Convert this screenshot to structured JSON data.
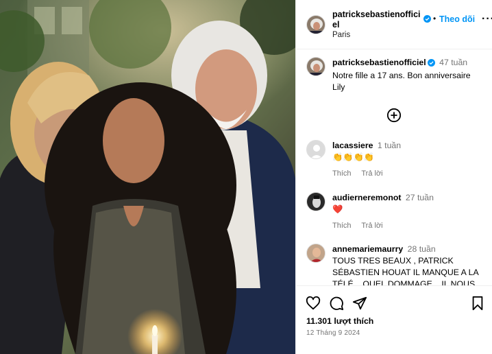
{
  "post_header": {
    "username": "patricksebastienofficiel",
    "follow_label": "Theo dõi",
    "location": "Paris",
    "more_label": "···"
  },
  "caption": {
    "username": "patricksebastienofficiel",
    "time": "47 tuần",
    "text": "Notre fille a 17 ans. Bon anniversaire Lily"
  },
  "load_more_icon": "plus-circle-icon",
  "comments": [
    {
      "username": "lacassiere",
      "time": "1 tuần",
      "text": "👏👏👏👏",
      "like_label": "Thích",
      "reply_label": "Trả lời"
    },
    {
      "username": "audierneremonot",
      "time": "27 tuần",
      "text": "❤️",
      "like_label": "Thích",
      "reply_label": "Trả lời"
    },
    {
      "username": "annemariemaurry",
      "time": "28 tuần",
      "text": "TOUS TRES BEAUX , PATRICK SÉBASTIEN HOUAT IL MANQUE A LA TÉLÉ ...QUEL DOMMAGE ...IL NOUS"
    }
  ],
  "footer": {
    "likes": "11.301 lượt thích",
    "date": "12 Tháng 9 2024",
    "icons": [
      "heart-icon",
      "comment-icon",
      "share-icon",
      "bookmark-icon"
    ]
  },
  "colors": {
    "accent": "#0095f6",
    "verified": "#0095f6",
    "muted": "#737373",
    "heart_red": "#ed4956"
  }
}
